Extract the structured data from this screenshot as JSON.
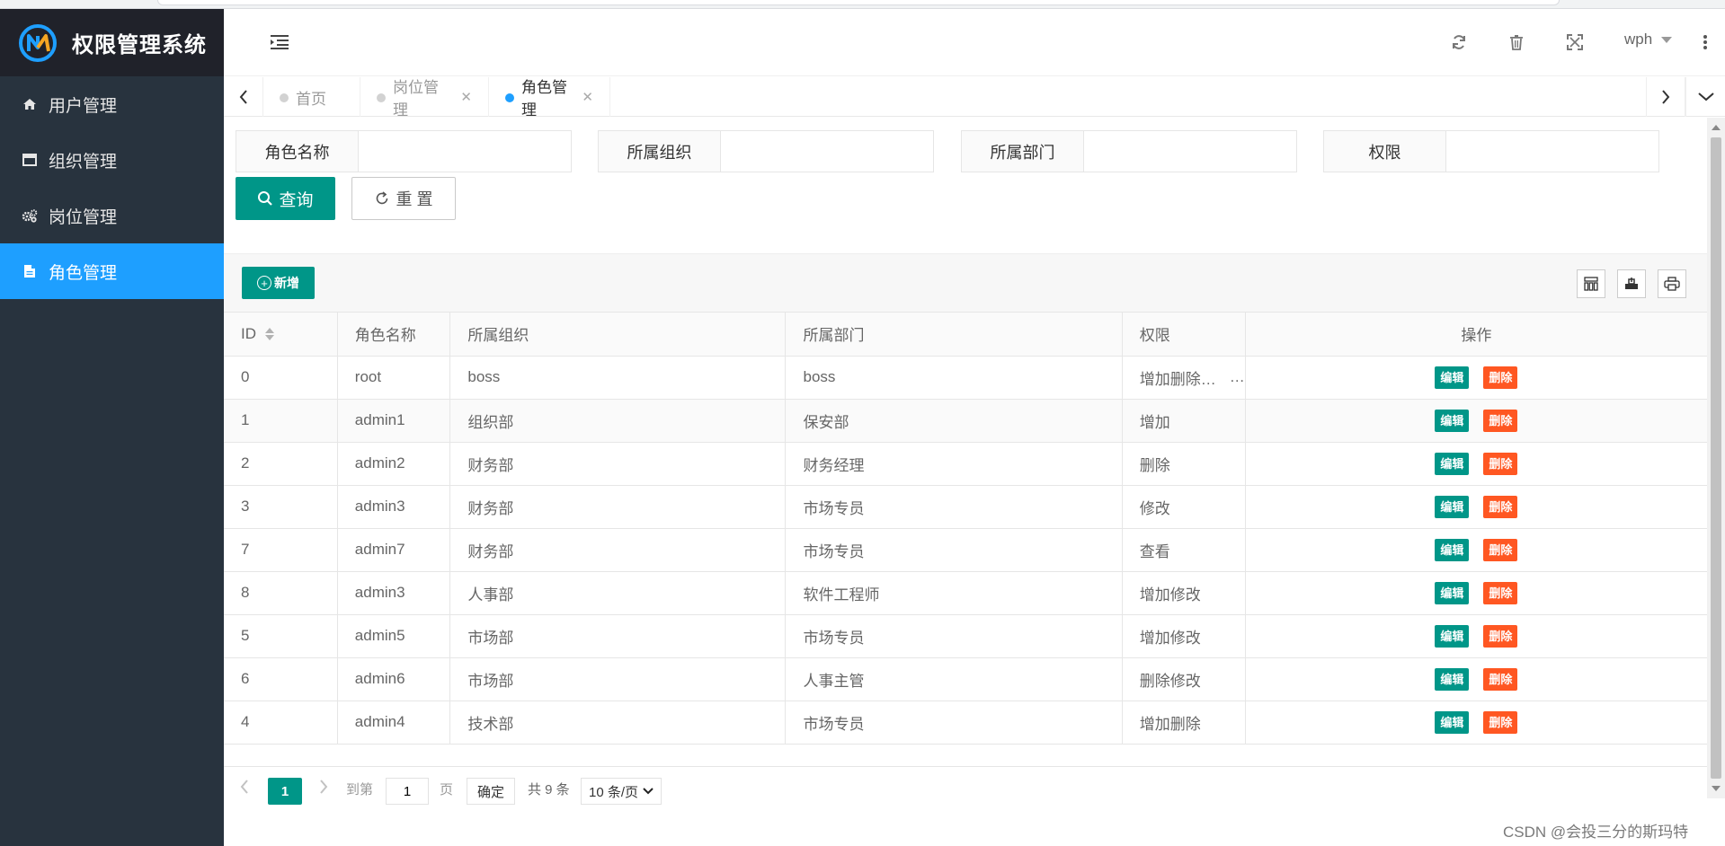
{
  "app": {
    "title": "权限管理系统"
  },
  "sidebar": {
    "items": [
      {
        "label": "用户管理",
        "icon": "home-icon",
        "active": false
      },
      {
        "label": "组织管理",
        "icon": "window-icon",
        "active": false
      },
      {
        "label": "岗位管理",
        "icon": "gears-icon",
        "active": false
      },
      {
        "label": "角色管理",
        "icon": "document-icon",
        "active": true
      }
    ]
  },
  "header": {
    "user": "wph",
    "icons": [
      "refresh-icon",
      "trash-icon",
      "fullscreen-icon",
      "more-vertical-icon"
    ]
  },
  "tabs": [
    {
      "label": "首页",
      "closable": false,
      "active": false
    },
    {
      "label": "岗位管理",
      "closable": true,
      "active": false
    },
    {
      "label": "角色管理",
      "closable": true,
      "active": true
    }
  ],
  "search": {
    "fields": [
      {
        "label": "角色名称",
        "value": ""
      },
      {
        "label": "所属组织",
        "value": ""
      },
      {
        "label": "所属部门",
        "value": ""
      },
      {
        "label": "权限",
        "value": ""
      }
    ],
    "query_label": "查询",
    "reset_label": "重 置"
  },
  "toolbar": {
    "add_label": "新增"
  },
  "table": {
    "columns": [
      "ID",
      "角色名称",
      "所属组织",
      "所属部门",
      "权限",
      "操作"
    ],
    "edit_label": "编辑",
    "delete_label": "删除",
    "rows": [
      {
        "id": "0",
        "name": "root",
        "org": "boss",
        "dept": "boss",
        "perm": "增加删除修改"
      },
      {
        "id": "1",
        "name": "admin1",
        "org": "组织部",
        "dept": "保安部",
        "perm": "增加"
      },
      {
        "id": "2",
        "name": "admin2",
        "org": "财务部",
        "dept": "财务经理",
        "perm": "删除"
      },
      {
        "id": "3",
        "name": "admin3",
        "org": "财务部",
        "dept": "市场专员",
        "perm": "修改"
      },
      {
        "id": "7",
        "name": "admin7",
        "org": "财务部",
        "dept": "市场专员",
        "perm": "查看"
      },
      {
        "id": "8",
        "name": "admin3",
        "org": "人事部",
        "dept": "软件工程师",
        "perm": "增加修改"
      },
      {
        "id": "5",
        "name": "admin5",
        "org": "市场部",
        "dept": "市场专员",
        "perm": "增加修改"
      },
      {
        "id": "6",
        "name": "admin6",
        "org": "市场部",
        "dept": "人事主管",
        "perm": "删除修改"
      },
      {
        "id": "4",
        "name": "admin4",
        "org": "技术部",
        "dept": "市场专员",
        "perm": "增加删除"
      }
    ]
  },
  "pager": {
    "current": "1",
    "goto_label": "到第",
    "page_input": "1",
    "page_unit": "页",
    "confirm_label": "确定",
    "total_label": "共 9 条",
    "page_size": "10 条/页"
  },
  "watermark": "CSDN @会投三分的斯玛特",
  "colors": {
    "sidebar": "#28333e",
    "active": "#1e9fff",
    "primary": "#009688",
    "danger": "#ff5722"
  }
}
